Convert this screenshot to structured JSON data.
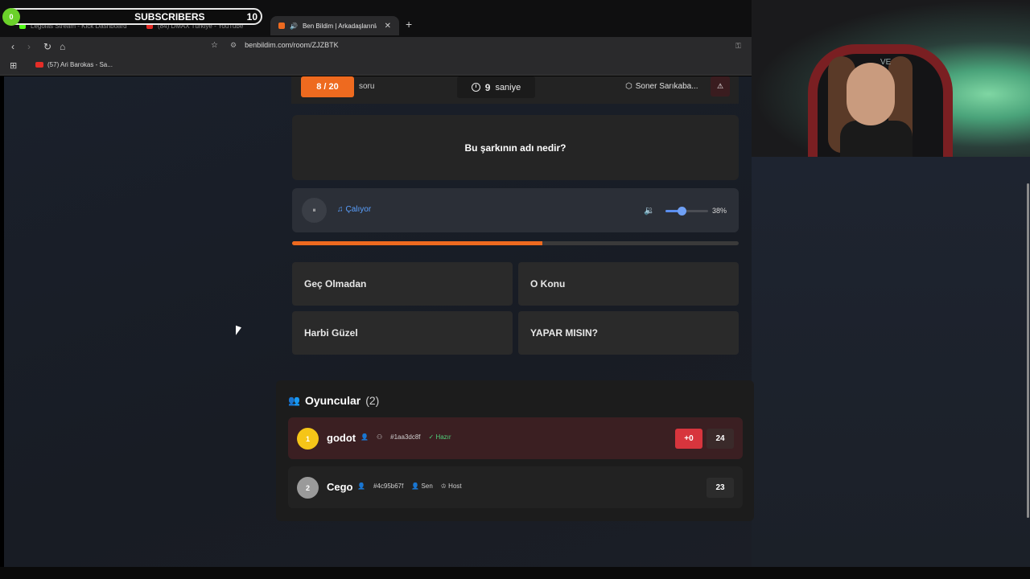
{
  "overlay": {
    "subscribers_badge": "0",
    "subscribers_label": "SUBSCRIBERS",
    "subscribers_count": "10"
  },
  "browser": {
    "tabs": [
      {
        "title": "Legolas Stream - Kick Dashboard",
        "color": "#53fc18"
      },
      {
        "title": "(84) DMAX Türkiye - YouTube",
        "color": "#e52d27"
      },
      {
        "title": "Ben Bildim | Arkadaşlarınla Oy...",
        "color": "#ee6a1f"
      }
    ],
    "url": "benbildim.com/room/ZJZBTK",
    "bookmark": "(57) Ari Barokas - Sa..."
  },
  "game": {
    "question_number": "8 / 20",
    "question_suffix": "soru",
    "timer_value": "9",
    "timer_unit": "saniye",
    "artist": "Soner Sarıkaba...",
    "warn_icon": "⚠",
    "question": "Bu şarkının adı nedir?",
    "player": {
      "pause_icon": "⏸",
      "status": "Çalıyor",
      "volume": 38,
      "volume_label": "38%"
    },
    "progress": 0.56,
    "answers": [
      "Geç Olmadan",
      "O Konu",
      "Harbi Güzel",
      "YAPAR MISIN?"
    ]
  },
  "players": {
    "title": "Oyuncular",
    "count": "(2)",
    "list": [
      {
        "rank": "1",
        "name": "godot",
        "id": "#1aa3dc8f",
        "tag": "Hazır",
        "delta": "+0",
        "score": "24",
        "rank_color": "#f5c518"
      },
      {
        "rank": "2",
        "name": "Cego",
        "id": "#4c95b67f",
        "tag": "Sen",
        "tag2": "Host",
        "score": "23",
        "rank_color": "#9a9a9a"
      }
    ]
  },
  "colors": {
    "accent": "#ee6a1f",
    "ready": "#4fd07a",
    "danger": "#d7353d",
    "link": "#5aa0ff"
  }
}
